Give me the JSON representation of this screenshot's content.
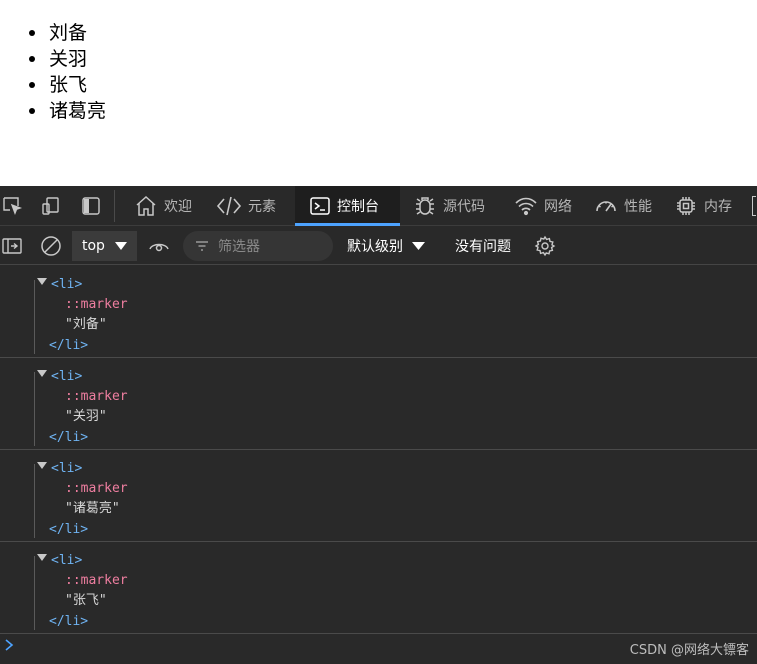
{
  "page": {
    "list_items": [
      "刘备",
      "关羽",
      "张飞",
      "诸葛亮"
    ]
  },
  "devtools": {
    "tabs": [
      {
        "label": "欢迎",
        "icon": "home-icon",
        "active": false
      },
      {
        "label": "元素",
        "icon": "code-brackets-icon",
        "active": false
      },
      {
        "label": "控制台",
        "icon": "console-icon",
        "active": true
      },
      {
        "label": "源代码",
        "icon": "bug-icon",
        "active": false
      },
      {
        "label": "网络",
        "icon": "wifi-icon",
        "active": false
      },
      {
        "label": "性能",
        "icon": "gauge-icon",
        "active": false
      },
      {
        "label": "内存",
        "icon": "chip-icon",
        "active": false
      }
    ],
    "toolbar": {
      "context": "top",
      "filter_placeholder": "筛选器",
      "level_label": "默认级别",
      "issues_label": "没有问题"
    },
    "console_entries": [
      {
        "open_tag": "<li>",
        "pseudo": "::marker",
        "text": "\"刘备\"",
        "close_tag": "</li>"
      },
      {
        "open_tag": "<li>",
        "pseudo": "::marker",
        "text": "\"关羽\"",
        "close_tag": "</li>"
      },
      {
        "open_tag": "<li>",
        "pseudo": "::marker",
        "text": "\"诸葛亮\"",
        "close_tag": "</li>"
      },
      {
        "open_tag": "<li>",
        "pseudo": "::marker",
        "text": "\"张飞\"",
        "close_tag": "</li>"
      }
    ]
  },
  "watermark": "CSDN @网络大镖客",
  "colors": {
    "panel_bg": "#292929",
    "active_tab_underline": "#4da3ff",
    "tag_color": "#6fb3f2",
    "pseudo_color": "#ee7ea0"
  }
}
